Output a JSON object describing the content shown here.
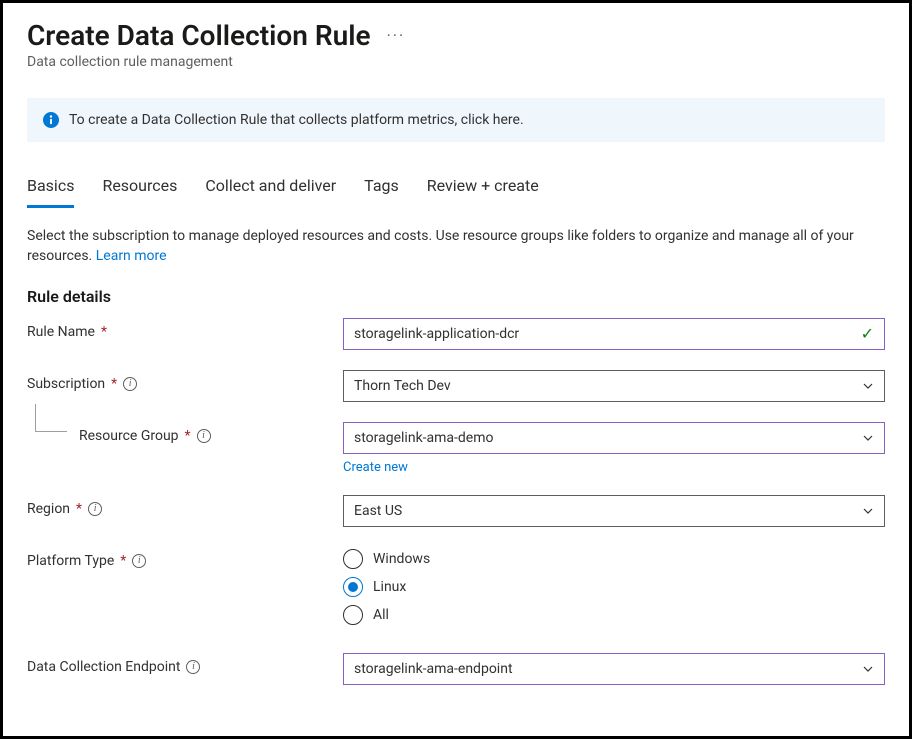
{
  "header": {
    "title": "Create Data Collection Rule",
    "subtitle": "Data collection rule management"
  },
  "info_banner": {
    "text": "To create a Data Collection Rule that collects platform metrics, click here."
  },
  "tabs": {
    "basics": "Basics",
    "resources": "Resources",
    "collect": "Collect and deliver",
    "tags": "Tags",
    "review": "Review + create"
  },
  "description": {
    "text_before": "Select the subscription to manage deployed resources and costs. Use resource groups like folders to organize and manage all of your resources. ",
    "learn_more": "Learn more"
  },
  "section_title": "Rule details",
  "fields": {
    "rule_name": {
      "label": "Rule Name",
      "value": "storagelink-application-dcr"
    },
    "subscription": {
      "label": "Subscription",
      "value": "Thorn Tech Dev"
    },
    "resource_group": {
      "label": "Resource Group",
      "value": "storagelink-ama-demo",
      "create_new": "Create new"
    },
    "region": {
      "label": "Region",
      "value": "East US"
    },
    "platform_type": {
      "label": "Platform Type",
      "options": {
        "windows": "Windows",
        "linux": "Linux",
        "all": "All"
      },
      "selected": "linux"
    },
    "endpoint": {
      "label": "Data Collection Endpoint",
      "value": "storagelink-ama-endpoint"
    }
  }
}
